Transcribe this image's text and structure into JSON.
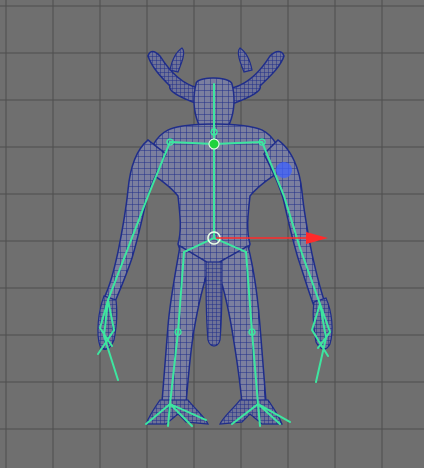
{
  "viewport": {
    "view": "front",
    "background_color": "#6f6f6f",
    "grid_line_color": "#4e4e4e",
    "mesh_color": "#1f2d8a",
    "mesh_fill_color": "#7b7f9f",
    "skeleton_color": "#3de6a0",
    "selected_joint_color": "#1fd23c",
    "manipulator_x_color": "#ff2a2a",
    "highlight_color": "#3f61ff"
  },
  "scene": {
    "model": "horned-humanoid",
    "joints_visible": true,
    "wireframe_on_shaded": true
  }
}
